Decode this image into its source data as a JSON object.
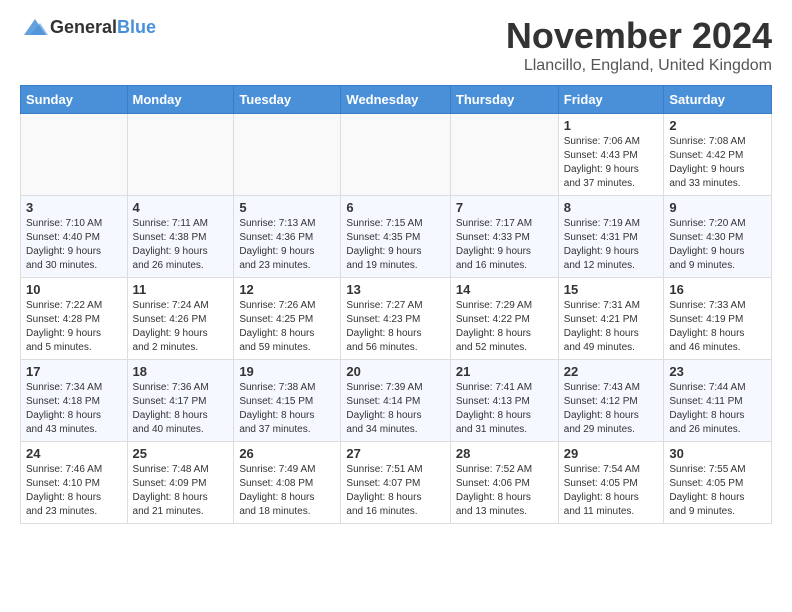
{
  "header": {
    "logo_general": "General",
    "logo_blue": "Blue",
    "month_title": "November 2024",
    "location": "Llancillo, England, United Kingdom"
  },
  "days_of_week": [
    "Sunday",
    "Monday",
    "Tuesday",
    "Wednesday",
    "Thursday",
    "Friday",
    "Saturday"
  ],
  "weeks": [
    [
      {
        "day": "",
        "info": ""
      },
      {
        "day": "",
        "info": ""
      },
      {
        "day": "",
        "info": ""
      },
      {
        "day": "",
        "info": ""
      },
      {
        "day": "",
        "info": ""
      },
      {
        "day": "1",
        "info": "Sunrise: 7:06 AM\nSunset: 4:43 PM\nDaylight: 9 hours\nand 37 minutes."
      },
      {
        "day": "2",
        "info": "Sunrise: 7:08 AM\nSunset: 4:42 PM\nDaylight: 9 hours\nand 33 minutes."
      }
    ],
    [
      {
        "day": "3",
        "info": "Sunrise: 7:10 AM\nSunset: 4:40 PM\nDaylight: 9 hours\nand 30 minutes."
      },
      {
        "day": "4",
        "info": "Sunrise: 7:11 AM\nSunset: 4:38 PM\nDaylight: 9 hours\nand 26 minutes."
      },
      {
        "day": "5",
        "info": "Sunrise: 7:13 AM\nSunset: 4:36 PM\nDaylight: 9 hours\nand 23 minutes."
      },
      {
        "day": "6",
        "info": "Sunrise: 7:15 AM\nSunset: 4:35 PM\nDaylight: 9 hours\nand 19 minutes."
      },
      {
        "day": "7",
        "info": "Sunrise: 7:17 AM\nSunset: 4:33 PM\nDaylight: 9 hours\nand 16 minutes."
      },
      {
        "day": "8",
        "info": "Sunrise: 7:19 AM\nSunset: 4:31 PM\nDaylight: 9 hours\nand 12 minutes."
      },
      {
        "day": "9",
        "info": "Sunrise: 7:20 AM\nSunset: 4:30 PM\nDaylight: 9 hours\nand 9 minutes."
      }
    ],
    [
      {
        "day": "10",
        "info": "Sunrise: 7:22 AM\nSunset: 4:28 PM\nDaylight: 9 hours\nand 5 minutes."
      },
      {
        "day": "11",
        "info": "Sunrise: 7:24 AM\nSunset: 4:26 PM\nDaylight: 9 hours\nand 2 minutes."
      },
      {
        "day": "12",
        "info": "Sunrise: 7:26 AM\nSunset: 4:25 PM\nDaylight: 8 hours\nand 59 minutes."
      },
      {
        "day": "13",
        "info": "Sunrise: 7:27 AM\nSunset: 4:23 PM\nDaylight: 8 hours\nand 56 minutes."
      },
      {
        "day": "14",
        "info": "Sunrise: 7:29 AM\nSunset: 4:22 PM\nDaylight: 8 hours\nand 52 minutes."
      },
      {
        "day": "15",
        "info": "Sunrise: 7:31 AM\nSunset: 4:21 PM\nDaylight: 8 hours\nand 49 minutes."
      },
      {
        "day": "16",
        "info": "Sunrise: 7:33 AM\nSunset: 4:19 PM\nDaylight: 8 hours\nand 46 minutes."
      }
    ],
    [
      {
        "day": "17",
        "info": "Sunrise: 7:34 AM\nSunset: 4:18 PM\nDaylight: 8 hours\nand 43 minutes."
      },
      {
        "day": "18",
        "info": "Sunrise: 7:36 AM\nSunset: 4:17 PM\nDaylight: 8 hours\nand 40 minutes."
      },
      {
        "day": "19",
        "info": "Sunrise: 7:38 AM\nSunset: 4:15 PM\nDaylight: 8 hours\nand 37 minutes."
      },
      {
        "day": "20",
        "info": "Sunrise: 7:39 AM\nSunset: 4:14 PM\nDaylight: 8 hours\nand 34 minutes."
      },
      {
        "day": "21",
        "info": "Sunrise: 7:41 AM\nSunset: 4:13 PM\nDaylight: 8 hours\nand 31 minutes."
      },
      {
        "day": "22",
        "info": "Sunrise: 7:43 AM\nSunset: 4:12 PM\nDaylight: 8 hours\nand 29 minutes."
      },
      {
        "day": "23",
        "info": "Sunrise: 7:44 AM\nSunset: 4:11 PM\nDaylight: 8 hours\nand 26 minutes."
      }
    ],
    [
      {
        "day": "24",
        "info": "Sunrise: 7:46 AM\nSunset: 4:10 PM\nDaylight: 8 hours\nand 23 minutes."
      },
      {
        "day": "25",
        "info": "Sunrise: 7:48 AM\nSunset: 4:09 PM\nDaylight: 8 hours\nand 21 minutes."
      },
      {
        "day": "26",
        "info": "Sunrise: 7:49 AM\nSunset: 4:08 PM\nDaylight: 8 hours\nand 18 minutes."
      },
      {
        "day": "27",
        "info": "Sunrise: 7:51 AM\nSunset: 4:07 PM\nDaylight: 8 hours\nand 16 minutes."
      },
      {
        "day": "28",
        "info": "Sunrise: 7:52 AM\nSunset: 4:06 PM\nDaylight: 8 hours\nand 13 minutes."
      },
      {
        "day": "29",
        "info": "Sunrise: 7:54 AM\nSunset: 4:05 PM\nDaylight: 8 hours\nand 11 minutes."
      },
      {
        "day": "30",
        "info": "Sunrise: 7:55 AM\nSunset: 4:05 PM\nDaylight: 8 hours\nand 9 minutes."
      }
    ]
  ]
}
